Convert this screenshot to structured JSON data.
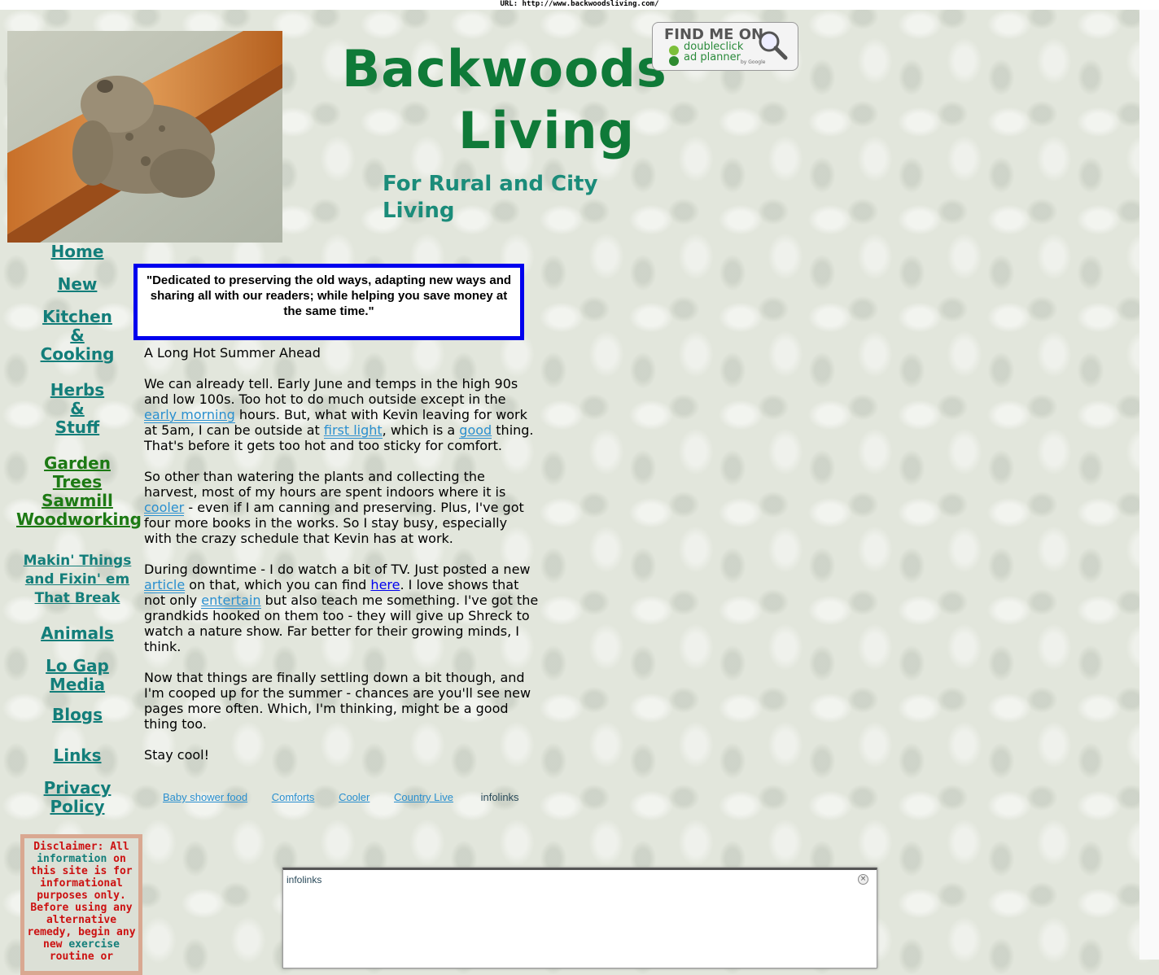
{
  "url_bar": "URL: http://www.backwoodsliving.com/",
  "header": {
    "title_line1": "Backwoods",
    "title_line2": "Living",
    "subtitle": "For Rural and City Living",
    "badge": {
      "line1": "FIND ME ON",
      "line2": "doubleclick",
      "line3": "ad planner",
      "line4": "by Google"
    }
  },
  "nav": {
    "home": "Home",
    "new": "New",
    "kitchen": [
      "Kitchen",
      "&",
      "Cooking"
    ],
    "herbs": [
      "Herbs",
      "&",
      "Stuff"
    ],
    "garden": [
      "Garden",
      "Trees",
      "Sawmill",
      "Woodworking"
    ],
    "makin": [
      "Makin' Things",
      "and Fixin' em",
      "That Break"
    ],
    "animals": "Animals",
    "logap": [
      "Lo Gap",
      "Media"
    ],
    "blogs": "Blogs",
    "links": "Links",
    "privacy": [
      "Privacy",
      "Policy"
    ]
  },
  "disclaimer": {
    "a": "Disclaimer:  All",
    "link1": "information",
    "b": " on this site is for informational purposes only. Before using any alternative remedy, begin any new ",
    "link2": "exercise",
    "c": " routine or"
  },
  "quote": "\"Dedicated to preserving the old ways, adapting new ways and sharing all with our readers; while helping you save money at the same time.\"",
  "article": {
    "heading": "A Long Hot Summer Ahead",
    "p1_a": "We can already tell.  Early June and temps in the high 90s and low 100s.  Too hot to do much outside except in the ",
    "p1_link1": "early morning",
    "p1_b": " hours.  But, what with Kevin leaving for work at 5am, I can be outside at ",
    "p1_link2": "first light",
    "p1_c": ", which is a ",
    "p1_link3": "good",
    "p1_d": " thing.  That's before it gets too hot and too sticky for comfort.",
    "p2_a": "So other than watering the plants and collecting the harvest, most of my hours are spent indoors where it is ",
    "p2_link": "cooler",
    "p2_b": " - even if I am canning and preserving.  Plus, I've got four more books in the works.  So I stay busy, especially with the crazy schedule that Kevin has at work.",
    "p3_a": "During downtime - I do watch a bit of TV.  Just posted a new ",
    "p3_link1": "article",
    "p3_b": " on that, which you can find ",
    "p3_link2": "here",
    "p3_c": ".  I love shows that not only ",
    "p3_link3": "entertain",
    "p3_d": " but also teach me something.  I've got the grandkids hooked on them too - they will give up Shreck to watch a nature show.  Far better for their growing minds, I think.",
    "p4": "Now that things are finally settling down a bit though, and I'm cooped up for the summer - chances are you'll see new pages more often.  Which, I'm thinking, might be a good thing too.",
    "p5": "Stay cool!"
  },
  "footer_links": [
    "Baby shower food",
    "Comforts",
    "Cooler",
    "Country Live"
  ],
  "infolinks_logo": "infolinks",
  "ad_frame": {
    "logo": "infolinks",
    "close": "×"
  },
  "colors": {
    "title_green": "#0f7a38",
    "nav_teal": "#137e7a",
    "nav_green": "#1d7a14",
    "quote_border": "#0000ee",
    "disclaimer_red": "#cc1111"
  }
}
